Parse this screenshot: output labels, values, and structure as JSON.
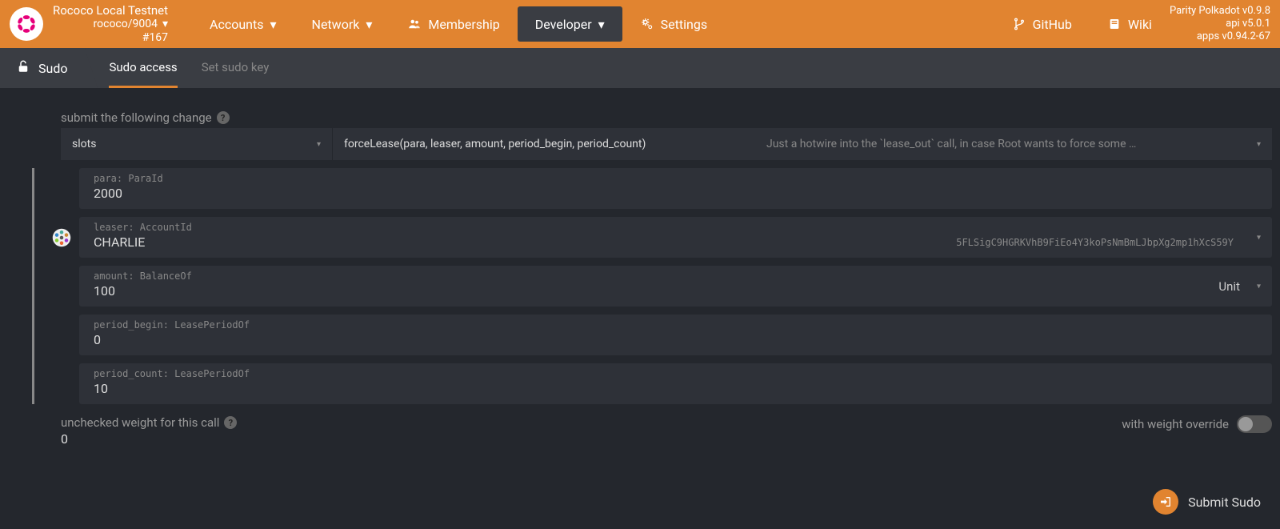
{
  "topbar": {
    "network_name": "Rococo Local Testnet",
    "network_spec": "rococo/9004",
    "block_num": "#167",
    "nav": {
      "accounts": "Accounts",
      "network": "Network",
      "membership": "Membership",
      "developer": "Developer",
      "settings": "Settings",
      "github": "GitHub",
      "wiki": "Wiki"
    },
    "versions": {
      "v1": "Parity Polkadot v0.9.8",
      "v2": "api v5.0.1",
      "v3": "apps v0.94.2-67"
    }
  },
  "subnav": {
    "title": "Sudo",
    "tabs": {
      "access": "Sudo access",
      "setkey": "Set sudo key"
    }
  },
  "form": {
    "submit_label": "submit the following change",
    "module": "slots",
    "method": "forceLease(para, leaser, amount, period_begin, period_count)",
    "method_desc": "Just a hotwire into the `lease_out` call, in case Root wants to force some …",
    "params": {
      "para": {
        "label": "para: ParaId",
        "value": "2000"
      },
      "leaser": {
        "label": "leaser: AccountId",
        "value": "CHARLIE",
        "address": "5FLSigC9HGRKVhB9FiEo4Y3koPsNmBmLJbpXg2mp1hXcS59Y"
      },
      "amount": {
        "label": "amount: BalanceOf",
        "value": "100",
        "unit": "Unit"
      },
      "period_begin": {
        "label": "period_begin: LeasePeriodOf",
        "value": "0"
      },
      "period_count": {
        "label": "period_count: LeasePeriodOf",
        "value": "10"
      }
    },
    "weight": {
      "label": "unchecked weight for this call",
      "value": "0",
      "override_label": "with weight override"
    },
    "submit_button": "Submit Sudo"
  }
}
